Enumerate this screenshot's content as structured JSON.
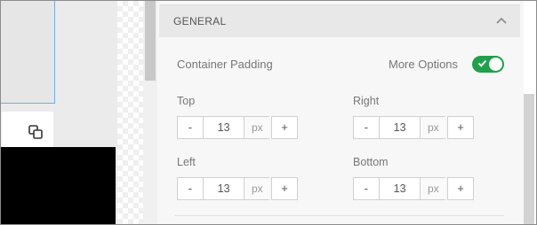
{
  "section": {
    "title": "GENERAL"
  },
  "container_padding": {
    "label": "Container Padding",
    "more_options_label": "More Options",
    "more_options_enabled": true
  },
  "fields": {
    "top": {
      "label": "Top",
      "value": "13",
      "unit": "px",
      "minus": "-",
      "plus": "+"
    },
    "right": {
      "label": "Right",
      "value": "13",
      "unit": "px",
      "minus": "-",
      "plus": "+"
    },
    "left": {
      "label": "Left",
      "value": "13",
      "unit": "px",
      "minus": "-",
      "plus": "+"
    },
    "bottom": {
      "label": "Bottom",
      "value": "13",
      "unit": "px",
      "minus": "-",
      "plus": "+"
    }
  },
  "colors": {
    "toggle_on": "#1fa04a",
    "selection_outline": "#6fb0e4"
  },
  "icons": {
    "collapse": "chevron-up-icon",
    "duplicate": "copy-icon",
    "toggle_check": "check-icon"
  }
}
